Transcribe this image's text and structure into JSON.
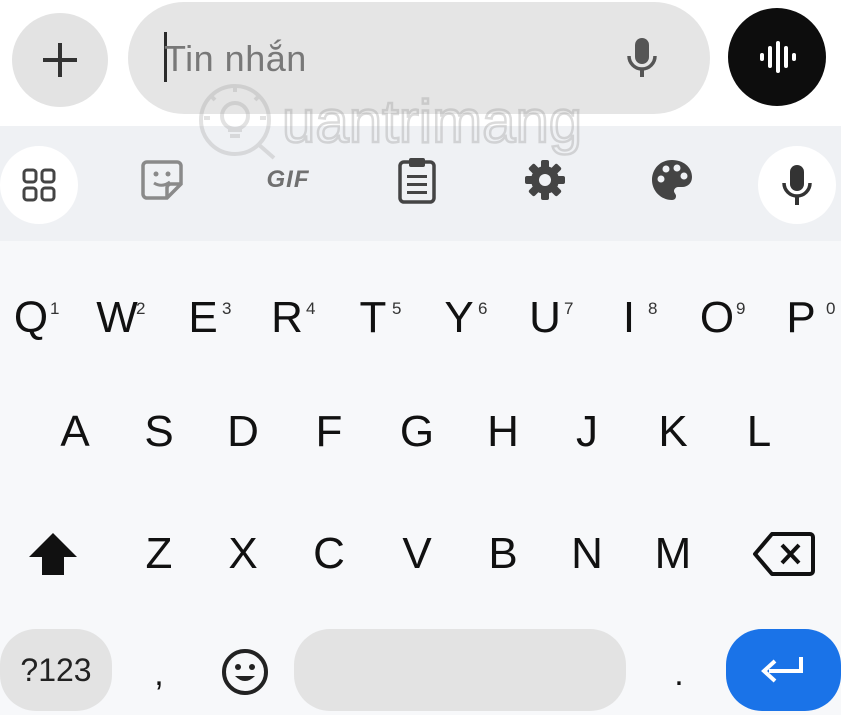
{
  "compose": {
    "add_icon": "plus-icon",
    "message_placeholder": "Tin nhắn",
    "field_mic_icon": "microphone-icon",
    "voice_icon": "voice-waveform-icon"
  },
  "watermark": {
    "text": "uantrimang"
  },
  "toolbar": {
    "items": [
      {
        "icon": "apps-grid-icon"
      },
      {
        "icon": "sticker-icon"
      },
      {
        "label": "GIF"
      },
      {
        "icon": "clipboard-icon"
      },
      {
        "icon": "gear-icon"
      },
      {
        "icon": "palette-icon"
      },
      {
        "icon": "microphone-icon"
      }
    ]
  },
  "keyboard": {
    "row1": [
      {
        "char": "Q",
        "hint": "1"
      },
      {
        "char": "W",
        "hint": "2"
      },
      {
        "char": "E",
        "hint": "3"
      },
      {
        "char": "R",
        "hint": "4"
      },
      {
        "char": "T",
        "hint": "5"
      },
      {
        "char": "Y",
        "hint": "6"
      },
      {
        "char": "U",
        "hint": "7"
      },
      {
        "char": "I",
        "hint": "8"
      },
      {
        "char": "O",
        "hint": "9"
      },
      {
        "char": "P",
        "hint": "0"
      }
    ],
    "row2": [
      "A",
      "S",
      "D",
      "F",
      "G",
      "H",
      "J",
      "K",
      "L"
    ],
    "row3": [
      "Z",
      "X",
      "C",
      "V",
      "B",
      "N",
      "M"
    ],
    "shift_icon": "shift-arrow-icon",
    "backspace_icon": "backspace-icon",
    "symbols_label": "?123",
    "comma_label": ",",
    "emoji_icon": "emoji-icon",
    "period_label": ".",
    "enter_icon": "enter-return-icon",
    "colors": {
      "enter": "#1a73e8",
      "pill": "#e3e3e3"
    }
  }
}
